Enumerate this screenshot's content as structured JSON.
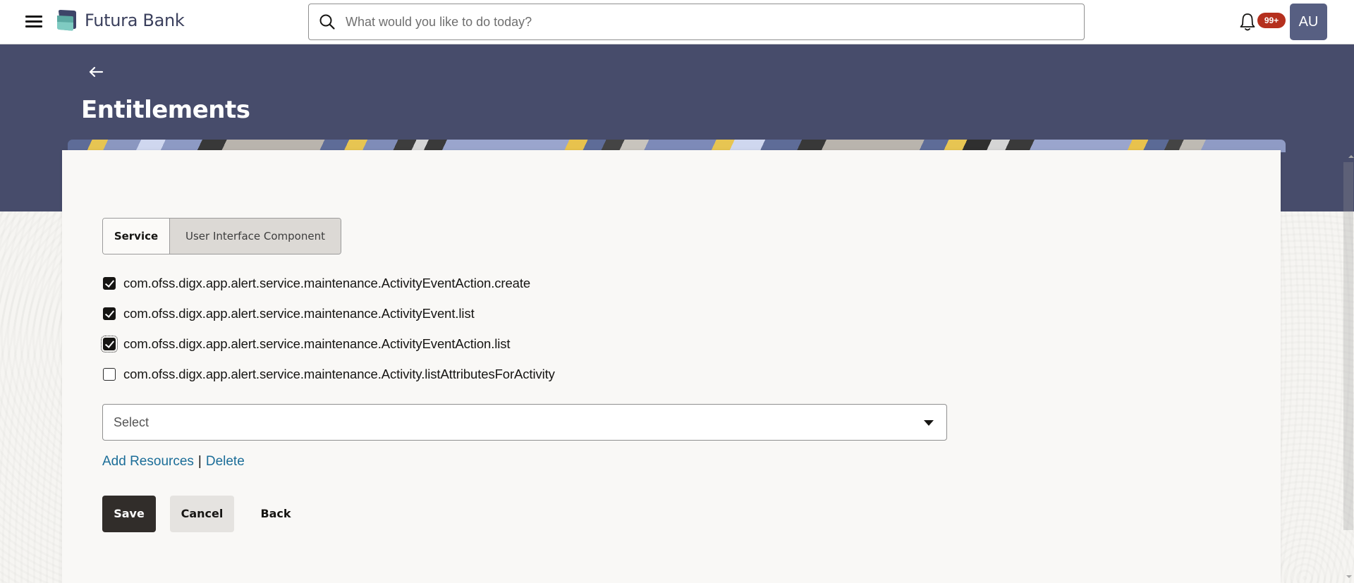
{
  "header": {
    "brand_name": "Futura Bank",
    "search_placeholder": "What would you like to do today?",
    "search_value": "",
    "notification_badge": "99+",
    "avatar_initials": "AU",
    "icons": {
      "menu": "hamburger-menu-icon",
      "logo": "futura-bank-logo-icon",
      "search": "search-icon",
      "notifications": "bell-icon",
      "back": "arrow-left-icon"
    }
  },
  "page": {
    "title": "Entitlements"
  },
  "tabs": [
    {
      "label": "Service",
      "active": true
    },
    {
      "label": "User Interface Component",
      "active": false
    }
  ],
  "resources": [
    {
      "label": "com.ofss.digx.app.alert.service.maintenance.ActivityEventAction.create",
      "checked": true,
      "focused": false
    },
    {
      "label": "com.ofss.digx.app.alert.service.maintenance.ActivityEvent.list",
      "checked": true,
      "focused": false
    },
    {
      "label": "com.ofss.digx.app.alert.service.maintenance.ActivityEventAction.list",
      "checked": true,
      "focused": true
    },
    {
      "label": "com.ofss.digx.app.alert.service.maintenance.Activity.listAttributesForActivity",
      "checked": false,
      "focused": false
    }
  ],
  "select": {
    "placeholder": "Select",
    "value": ""
  },
  "links": {
    "add_resources": "Add Resources",
    "separator": "|",
    "delete": "Delete"
  },
  "buttons": {
    "save": "Save",
    "cancel": "Cancel",
    "back": "Back"
  },
  "colors": {
    "banner": "#474c6b",
    "avatar": "#575f82",
    "badge": "#b5301e",
    "primary_button": "#312d2a",
    "link": "#1b6d98"
  }
}
